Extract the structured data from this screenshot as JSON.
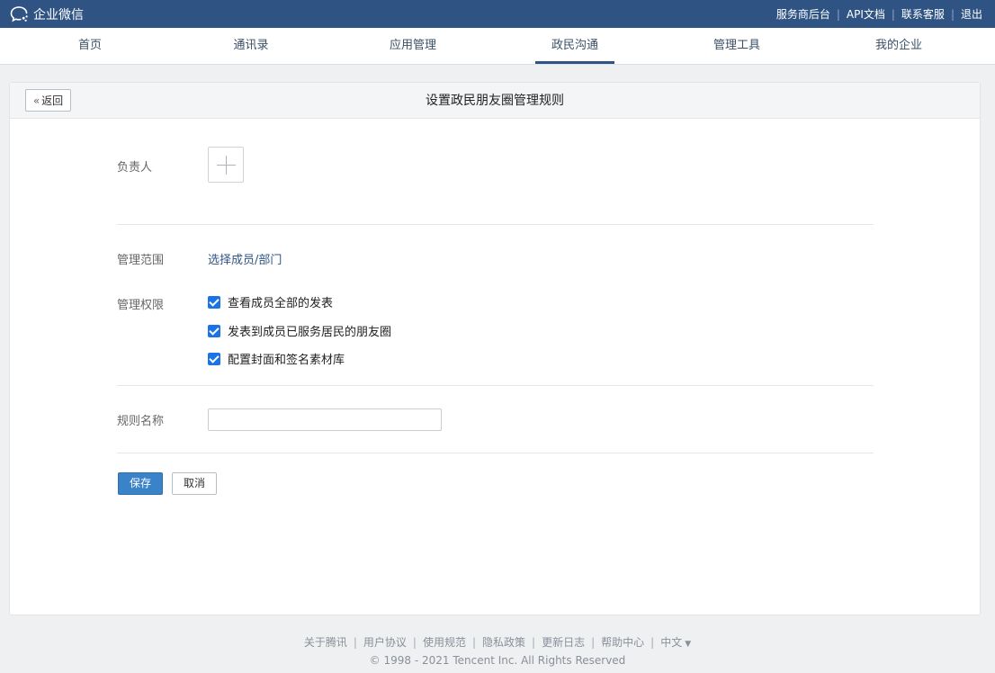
{
  "brand": {
    "name": "企业微信",
    "icon": "wework-logo-icon"
  },
  "top_links": [
    "服务商后台",
    "API文档",
    "联系客服",
    "退出"
  ],
  "nav": {
    "items": [
      "首页",
      "通讯录",
      "应用管理",
      "政民沟通",
      "管理工具",
      "我的企业"
    ],
    "active": "政民沟通"
  },
  "page": {
    "back_label": "返回",
    "title": "设置政民朋友圈管理规则"
  },
  "form": {
    "owner_label": "负责人",
    "scope_label": "管理范围",
    "scope_link": "选择成员/部门",
    "permissions_label": "管理权限",
    "permissions": [
      {
        "label": "查看成员全部的发表",
        "checked": true
      },
      {
        "label": "发表到成员已服务居民的朋友圈",
        "checked": true
      },
      {
        "label": "配置封面和签名素材库",
        "checked": true
      }
    ],
    "rule_name_label": "规则名称",
    "rule_name_value": "",
    "save_label": "保存",
    "cancel_label": "取消"
  },
  "footer": {
    "links": [
      "关于腾讯",
      "用户协议",
      "使用规范",
      "隐私政策",
      "更新日志",
      "帮助中心"
    ],
    "language": "中文",
    "copyright": "© 1998 - 2021 Tencent Inc. All Rights Reserved"
  },
  "colors": {
    "topbar": "#2f5484",
    "primary": "#3a83c9",
    "checkbox": "#1a73e8",
    "link": "#2f5484"
  }
}
